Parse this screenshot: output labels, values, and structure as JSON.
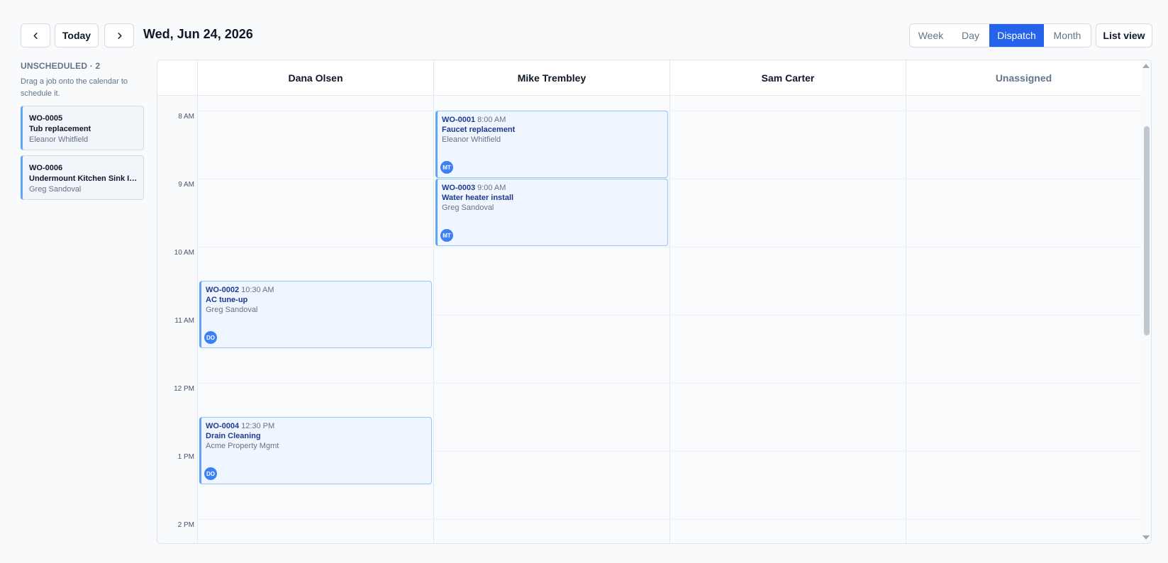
{
  "toolbar": {
    "prev_icon": "chevron-left-icon",
    "today_label": "Today",
    "next_icon": "chevron-right-icon",
    "date_title": "Wed, Jun 24, 2026",
    "view_tabs": [
      {
        "label": "Week",
        "active": false
      },
      {
        "label": "Day",
        "active": false
      },
      {
        "label": "Dispatch",
        "active": true
      },
      {
        "label": "Month",
        "active": false
      }
    ],
    "list_view_label": "List view"
  },
  "unscheduled": {
    "title": "UNSCHEDULED · 2",
    "hint": "Drag a job onto the calendar to schedule it.",
    "jobs": [
      {
        "id": "WO-0005",
        "title": "Tub replacement",
        "client": "Eleanor Whitfield"
      },
      {
        "id": "WO-0006",
        "title": "Undermount Kitchen Sink Install",
        "client": "Greg Sandoval"
      }
    ]
  },
  "calendar": {
    "columns": [
      "Dana Olsen",
      "Mike Trembley",
      "Sam Carter",
      "Unassigned"
    ],
    "hours": [
      "8 AM",
      "9 AM",
      "10 AM",
      "11 AM",
      "12 PM",
      "1 PM",
      "2 PM"
    ],
    "events": [
      {
        "id": "WO-0001",
        "time": "8:00 AM",
        "title": "Faucet replacement",
        "client": "Eleanor Whitfield",
        "initials": "MT",
        "tech": "Mike Trembley"
      },
      {
        "id": "WO-0003",
        "time": "9:00 AM",
        "title": "Water heater install",
        "client": "Greg Sandoval",
        "initials": "MT",
        "tech": "Mike Trembley"
      },
      {
        "id": "WO-0002",
        "time": "10:30 AM",
        "title": "AC tune-up",
        "client": "Greg Sandoval",
        "initials": "DO",
        "tech": "Dana Olsen"
      },
      {
        "id": "WO-0004",
        "time": "12:30 PM",
        "title": "Drain Cleaning",
        "client": "Acme Property Mgmt",
        "initials": "DO",
        "tech": "Dana Olsen"
      }
    ]
  },
  "colors": {
    "accent": "#2563eb",
    "event_bg": "#eff6ff",
    "event_border": "#60a5fa",
    "avatar": "#3b82f6"
  }
}
